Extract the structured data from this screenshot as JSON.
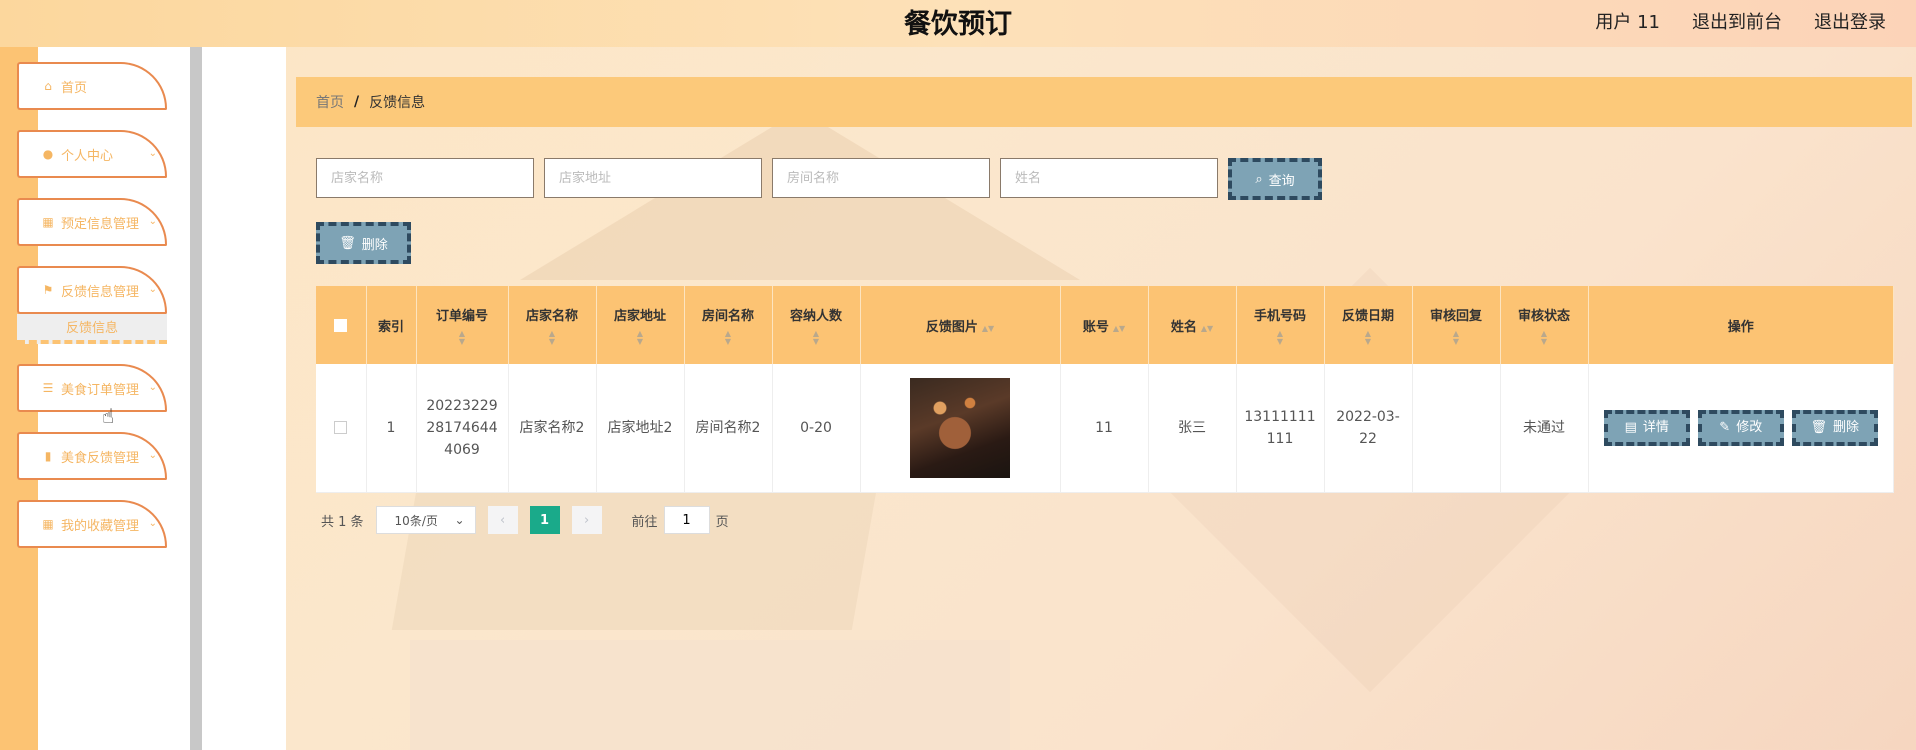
{
  "header": {
    "title": "餐饮预订",
    "user": "用户 11",
    "back_front": "退出到前台",
    "logout": "退出登录"
  },
  "sidebar": {
    "items": [
      {
        "label": "首页",
        "icon": "home-icon"
      },
      {
        "label": "个人中心",
        "icon": "user-icon"
      },
      {
        "label": "预定信息管理",
        "icon": "grid-icon"
      },
      {
        "label": "反馈信息管理",
        "icon": "flag-icon"
      },
      {
        "label": "美食订单管理",
        "icon": "sliders-icon"
      },
      {
        "label": "美食反馈管理",
        "icon": "clipboard-icon"
      },
      {
        "label": "我的收藏管理",
        "icon": "grid-icon"
      }
    ],
    "subitem": "反馈信息"
  },
  "breadcrumb": {
    "home": "首页",
    "separator": "/",
    "current": "反馈信息"
  },
  "search": {
    "store_name_placeholder": "店家名称",
    "store_addr_placeholder": "店家地址",
    "room_name_placeholder": "房间名称",
    "name_placeholder": "姓名",
    "search_label": "查询"
  },
  "actions": {
    "delete_label": "删除"
  },
  "table": {
    "headers": [
      "索引",
      "订单编号",
      "店家名称",
      "店家地址",
      "房间名称",
      "容纳人数",
      "反馈图片",
      "账号",
      "姓名",
      "手机号码",
      "反馈日期",
      "审核回复",
      "审核状态",
      "操作"
    ],
    "rows": [
      {
        "index": "1",
        "order_no": "20223229 28174644 4069",
        "store_name": "店家名称2",
        "store_addr": "店家地址2",
        "room_name": "房间名称2",
        "capacity": "0-20",
        "account": "11",
        "name": "张三",
        "phone": "13111111 111",
        "date": "2022-03- 22",
        "reply": "",
        "status": "未通过"
      }
    ],
    "ops": {
      "detail": "详情",
      "edit": "修改",
      "delete": "删除"
    }
  },
  "pager": {
    "total": "共 1 条",
    "page_size": "10条/页",
    "current": "1",
    "goto_prefix": "前往",
    "goto_value": "1",
    "goto_suffix": "页"
  },
  "colors": {
    "accent": "#fcc373",
    "button": "#7ea3b5",
    "page_active": "#1aaa8a"
  }
}
